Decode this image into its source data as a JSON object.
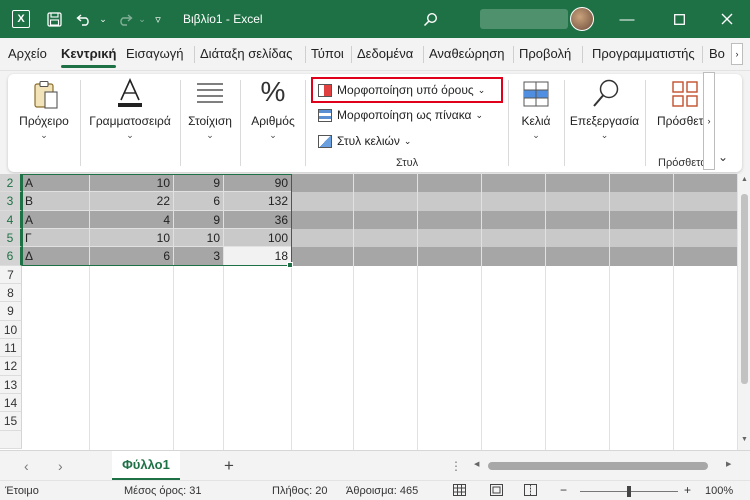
{
  "titlebar": {
    "app_icon": "excel-logo-icon",
    "title": "Βιβλίο1  -  Excel"
  },
  "tabs": [
    "Αρχείο",
    "Κεντρική",
    "Εισαγωγή",
    "Διάταξη σελίδας",
    "Τύποι",
    "Δεδομένα",
    "Αναθεώρηση",
    "Προβολή",
    "Προγραμματιστής",
    "Βο"
  ],
  "ribbon": {
    "clipboard": "Πρόχειρο",
    "font": "Γραμματοσειρά",
    "alignment": "Στοίχιση",
    "number": "Αριθμός",
    "conditional_formatting": "Μορφοποίηση υπό όρους",
    "format_as_table": "Μορφοποίηση ως πίνακα",
    "cell_styles": "Στυλ κελιών",
    "styles_group": "Στυλ",
    "cells": "Κελιά",
    "editing": "Επεξεργασία",
    "addins": "Πρόσθετα",
    "addins_group": "Πρόσθετα"
  },
  "grid": {
    "rows": [
      {
        "num": "2",
        "a": "A",
        "b": "10",
        "c": "9",
        "d": "90"
      },
      {
        "num": "3",
        "a": "B",
        "b": "22",
        "c": "6",
        "d": "132"
      },
      {
        "num": "4",
        "a": "A",
        "b": "4",
        "c": "9",
        "d": "36"
      },
      {
        "num": "5",
        "a": "Γ",
        "b": "10",
        "c": "10",
        "d": "100"
      },
      {
        "num": "6",
        "a": "Δ",
        "b": "6",
        "c": "3",
        "d": "18"
      }
    ],
    "empty_rows": [
      "7",
      "8",
      "9",
      "10",
      "11",
      "12",
      "13",
      "14",
      "15"
    ]
  },
  "sheet": {
    "name": "Φύλλο1",
    "add": "+"
  },
  "status": {
    "ready": "Έτοιμο",
    "average": "Μέσος όρος: 31",
    "count": "Πλήθος: 20",
    "sum": "Άθροισμα: 465",
    "zoom": "100%",
    "zoom_minus": "−",
    "zoom_plus": "+"
  }
}
